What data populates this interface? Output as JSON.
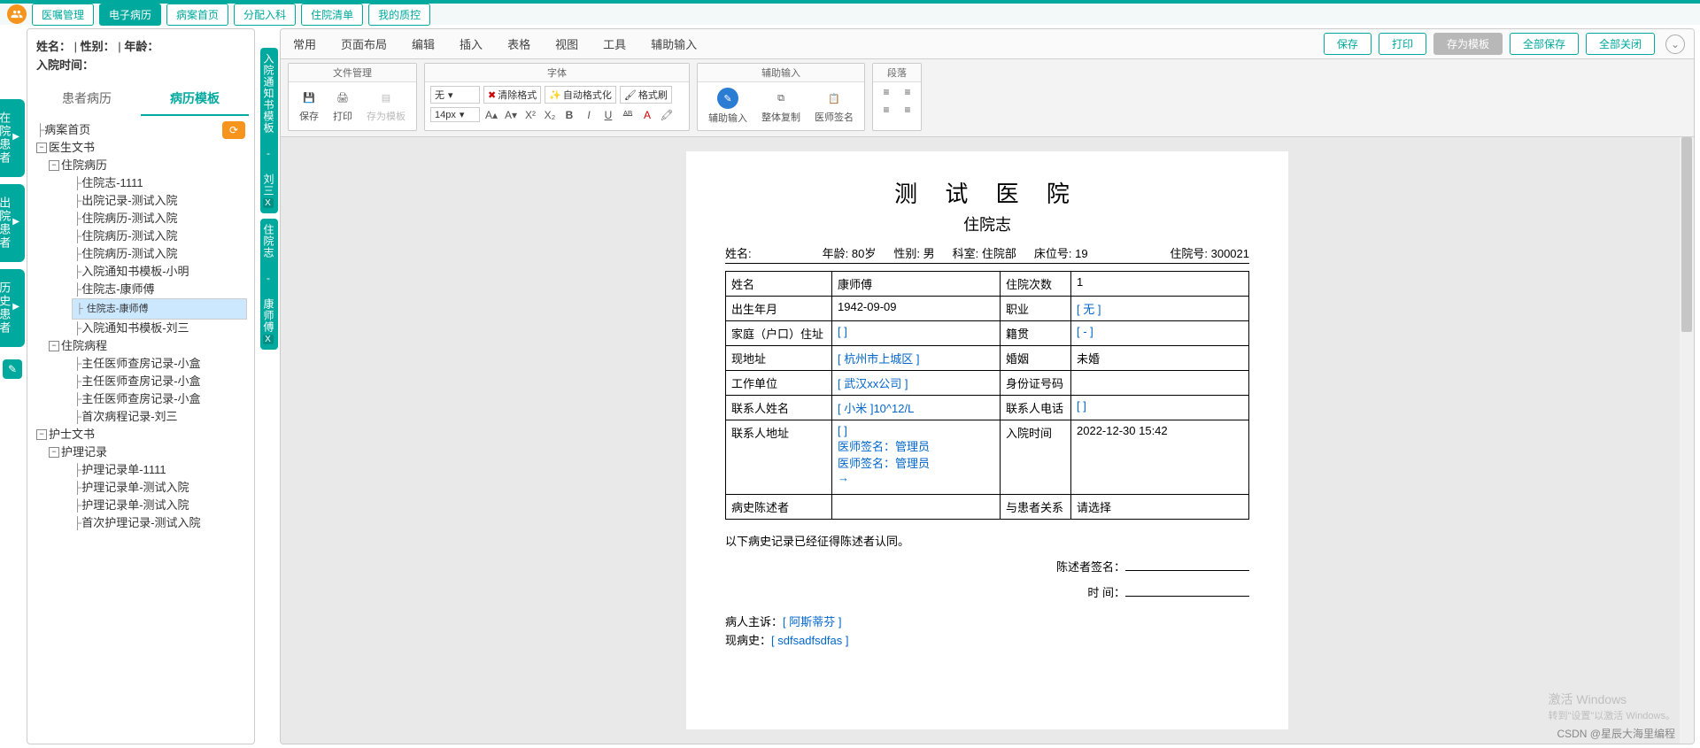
{
  "nav": {
    "items": [
      "医嘱管理",
      "电子病历",
      "病案首页",
      "分配入科",
      "住院清单",
      "我的质控"
    ],
    "activeIndex": 1
  },
  "patient": {
    "name_lbl": "姓名：",
    "sep": "|",
    "sex_lbl": "性别：",
    "age_lbl": "年龄：",
    "admit_lbl": "入院时间："
  },
  "sideTabs": {
    "a": "患者病历",
    "b": "病历模板"
  },
  "rail": {
    "a": "在院患者",
    "b": "出院患者",
    "c": "历史患者"
  },
  "tree": {
    "root": "病案首页",
    "n1": "医生文书",
    "n1a": "住院病历",
    "n1a_items": [
      "住院志-1111",
      "出院记录-测试入院",
      "住院病历-测试入院",
      "住院病历-测试入院",
      "住院病历-测试入院",
      "入院通知书模板-小明",
      "住院志-康师傅",
      "住院志-康师傅",
      "入院通知书模板-刘三"
    ],
    "n1b": "住院病程",
    "n1b_items": [
      "主任医师查房记录-小盒",
      "主任医师查房记录-小盒",
      "主任医师查房记录-小盒",
      "首次病程记录-刘三"
    ],
    "n2": "护士文书",
    "n2a": "护理记录",
    "n2a_items": [
      "护理记录单-1111",
      "护理记录单-测试入院",
      "护理记录单-测试入院",
      "首次护理记录-测试入院"
    ]
  },
  "vtabs": {
    "a": "入院通知书模板 - 刘三",
    "ax": "X",
    "b": "住院志 - 康师傅",
    "bx": "X"
  },
  "menu": [
    "常用",
    "页面布局",
    "编辑",
    "插入",
    "表格",
    "视图",
    "工具",
    "辅助输入"
  ],
  "actions": {
    "save": "保存",
    "print": "打印",
    "saveTpl": "存为模板",
    "saveAll": "全部保存",
    "closeAll": "全部关闭"
  },
  "ribbon": {
    "g1": "文件管理",
    "g1_save": "保存",
    "g1_print": "打印",
    "g1_tpl": "存为模板",
    "g2": "字体",
    "font": "无",
    "size": "14px",
    "clearFmt": "清除格式",
    "autoFmt": "自动格式化",
    "fmtBrush": "格式刷",
    "g3": "辅助输入",
    "g3_a": "辅助输入",
    "g3_b": "整体复制",
    "g3_c": "医师签名",
    "g4": "段落"
  },
  "doc": {
    "title": "测 试 医 院",
    "subtitle": "住院志",
    "meta": {
      "name_l": "姓名:",
      "age_l": "年龄:",
      "age_v": "80岁",
      "sex_l": "性别:",
      "sex_v": "男",
      "dept_l": "科室:",
      "dept_v": "住院部",
      "bed_l": "床位号:",
      "bed_v": "19",
      "adm_l": "住院号:",
      "adm_v": "300021"
    },
    "rows": [
      {
        "l1": "姓名",
        "v1": "康师傅",
        "l2": "住院次数",
        "v2": "1"
      },
      {
        "l1": "出生年月",
        "v1": "1942-09-09",
        "l2": "职业",
        "v2": "[ 无 ]",
        "ph2": true
      },
      {
        "l1": "家庭（户口）住址",
        "v1": "[ ]",
        "ph1": true,
        "l2": "籍贯",
        "v2": "[           - ]",
        "ph2": true
      },
      {
        "l1": "现地址",
        "v1": "[ 杭州市上城区 ]",
        "ph1": true,
        "l2": "婚姻",
        "v2": "未婚"
      },
      {
        "l1": "工作单位",
        "v1": "[ 武汉xx公司 ]",
        "ph1": true,
        "l2": "身份证号码",
        "v2": ""
      },
      {
        "l1": "联系人姓名",
        "v1": "[ 小米 ]10^12/L",
        "ph1": true,
        "l2": "联系人电话",
        "v2": "[ ]",
        "ph2": true
      },
      {
        "l1": "联系人地址",
        "v1": "[ ]\n    医师签名：管理员\n    医师签名：管理员\n→",
        "ph1": true,
        "l2": "入院时间",
        "v2": "2022-12-30 15:42"
      },
      {
        "l1": "病史陈述者",
        "v1": "",
        "l2": "与患者关系",
        "v2": "请选择"
      }
    ],
    "consent": "以下病史记录已经征得陈述者认同。",
    "sig_l": "陈述者签名：",
    "time_l": "时        间：",
    "chief_l": "病人主诉：",
    "chief_v": "[ 阿斯蒂芬 ]",
    "hpi_l": "现病史：",
    "hpi_v": "[ sdfsadfsdfas ]"
  },
  "wm": {
    "a": "激活 Windows",
    "b": "转到\"设置\"以激活 Windows。"
  },
  "csdn": "CSDN @星辰大海里编程"
}
